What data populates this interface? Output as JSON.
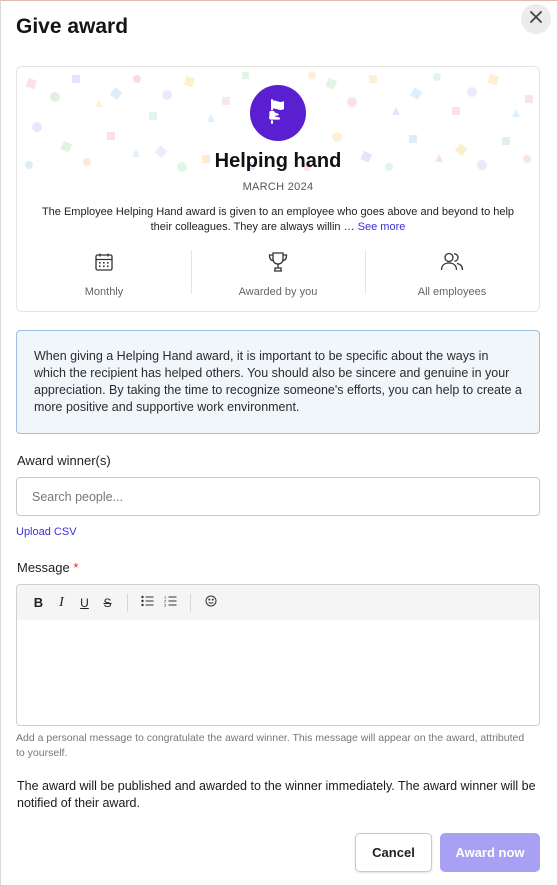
{
  "dialog": {
    "title": "Give award"
  },
  "award": {
    "name": "Helping hand",
    "date": "MARCH 2024",
    "description": "The Employee Helping Hand award is given to an employee who goes above and beyond to help their colleagues. They are always willin …",
    "see_more": "See more",
    "badge_color": "#5a1fd1",
    "stats": [
      {
        "icon": "calendar-icon",
        "label": "Monthly"
      },
      {
        "icon": "trophy-icon",
        "label": "Awarded by you"
      },
      {
        "icon": "users-icon",
        "label": "All employees"
      }
    ]
  },
  "info": {
    "text": "When giving a Helping Hand award, it is important to be specific about the ways in which the recipient has helped others. You should also be sincere and genuine in your appreciation. By taking the time to recognize someone's efforts, you can help to create a more positive and supportive work environment."
  },
  "winner": {
    "label": "Award winner(s)",
    "placeholder": "Search people...",
    "value": "",
    "upload_csv": "Upload CSV"
  },
  "message": {
    "label": "Message",
    "required_mark": "*",
    "toolbar": [
      "bold",
      "italic",
      "underline",
      "strikethrough",
      "bulleted-list",
      "numbered-list",
      "emoji"
    ],
    "hint": "Add a personal message to congratulate the award winner. This message will appear on the award, attributed to yourself."
  },
  "notice": {
    "text": "The award will be published and awarded to the winner immediately. The award winner will be notified of their award."
  },
  "actions": {
    "cancel": "Cancel",
    "submit": "Award now",
    "submit_color": "#a8a0f2"
  }
}
